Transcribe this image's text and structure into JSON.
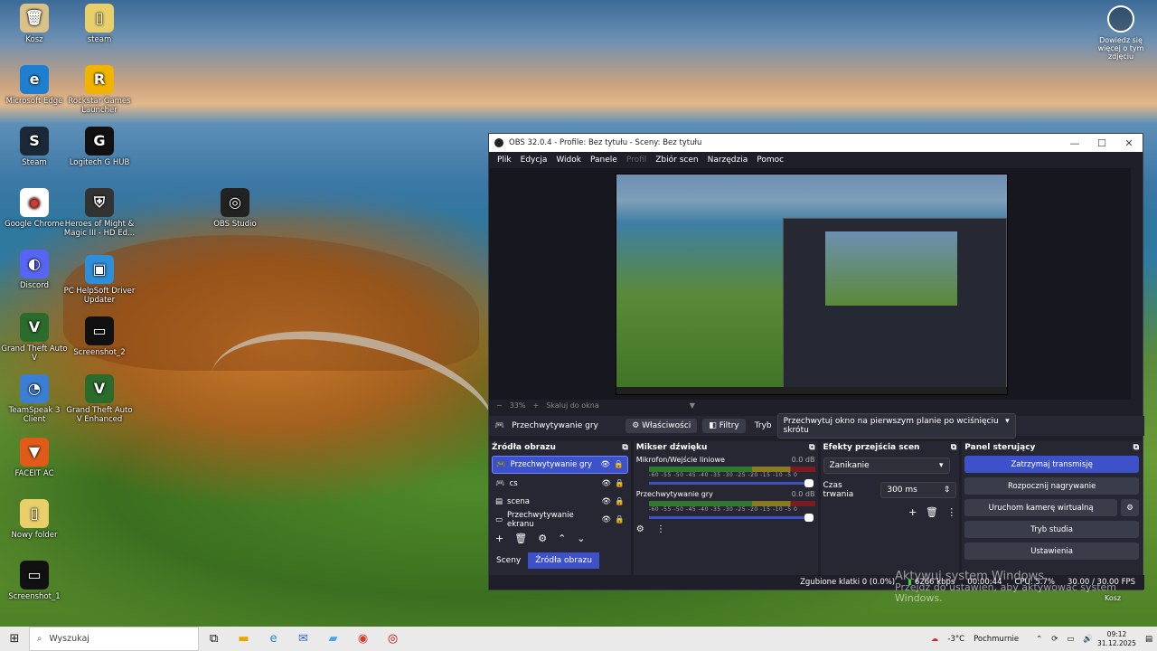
{
  "desktop": {
    "icons": [
      {
        "label": "Kosz",
        "icon": "recycle-bin-icon",
        "glyph": "🗑"
      },
      {
        "label": "steam",
        "icon": "folder-icon",
        "glyph": "▯"
      },
      {
        "label": "Microsoft Edge",
        "icon": "edge-icon",
        "glyph": "e"
      },
      {
        "label": "Rockstar Games Launcher",
        "icon": "rockstar-icon",
        "glyph": "R"
      },
      {
        "label": "Steam",
        "icon": "steam-icon",
        "glyph": "S"
      },
      {
        "label": "Logitech G HUB",
        "icon": "logitech-icon",
        "glyph": "G"
      },
      {
        "label": "Google Chrome",
        "icon": "chrome-icon",
        "glyph": "◉"
      },
      {
        "label": "Heroes of Might & Magic III - HD Ed...",
        "icon": "heroes-icon",
        "glyph": "⛨"
      },
      {
        "label": "OBS Studio",
        "icon": "obs-icon",
        "glyph": "◎"
      },
      {
        "label": "Discord",
        "icon": "discord-icon",
        "glyph": "◐"
      },
      {
        "label": "PC HelpSoft Driver Updater",
        "icon": "driver-updater-icon",
        "glyph": "▣"
      },
      {
        "label": "Grand Theft Auto V",
        "icon": "gta-icon",
        "glyph": "V"
      },
      {
        "label": "Screenshot_2",
        "icon": "screenshot-icon",
        "glyph": "▭"
      },
      {
        "label": "TeamSpeak 3 Client",
        "icon": "teamspeak-icon",
        "glyph": "◔"
      },
      {
        "label": "Grand Theft Auto V Enhanced",
        "icon": "gta-enhanced-icon",
        "glyph": "V"
      },
      {
        "label": "FACEIT AC",
        "icon": "faceit-icon",
        "glyph": "▼"
      },
      {
        "label": "Nowy folder",
        "icon": "folder-icon",
        "glyph": "▯"
      },
      {
        "label": "Screenshot_1",
        "icon": "screenshot-icon",
        "glyph": "▭"
      }
    ],
    "corner": {
      "label": "Dowiedz się więcej o tym zdjęciu"
    }
  },
  "obs": {
    "title": "OBS 32.0.4 - Profile: Bez tytułu - Sceny: Bez tytułu",
    "menu": [
      "Plik",
      "Edycja",
      "Widok",
      "Panele",
      "Profil",
      "Zbiór scen",
      "Narzędzia",
      "Pomoc"
    ],
    "zoom": {
      "minus": "−",
      "value": "33%",
      "plus": "+",
      "fit": "Skaluj do okna"
    },
    "source_bar": {
      "name": "Przechwytywanie gry",
      "properties": "Właściwości",
      "filters": "Filtry",
      "mode_label": "Tryb",
      "mode_value": "Przechwytuj okno na pierwszym planie po wciśnięciu skrótu"
    },
    "sources": {
      "title": "Źródła obrazu",
      "items": [
        {
          "name": "Przechwytywanie gry",
          "icon": "gamepad-icon"
        },
        {
          "name": "cs",
          "icon": "gamepad-icon"
        },
        {
          "name": "scena",
          "icon": "scene-icon"
        },
        {
          "name": "Przechwytywanie ekranu",
          "icon": "monitor-icon"
        }
      ]
    },
    "mixer": {
      "title": "Mikser dźwięku",
      "tracks": [
        {
          "name": "Mikrofon/Wejście liniowe",
          "db": "0.0 dB"
        },
        {
          "name": "Przechwytywanie gry",
          "db": "0.0 dB"
        }
      ],
      "ticks": "-60 -55 -50 -45 -40 -35 -30 -25 -20 -15 -10 -5 0"
    },
    "transitions": {
      "title": "Efekty przejścia scen",
      "type": "Zanikanie",
      "duration_label": "Czas trwania",
      "duration_value": "300 ms"
    },
    "controls": {
      "title": "Panel sterujący",
      "stop_stream": "Zatrzymaj transmisję",
      "start_record": "Rozpocznij nagrywanie",
      "virtual_cam": "Uruchom kamerę wirtualną",
      "studio_mode": "Tryb studia",
      "settings": "Ustawienia"
    },
    "tabs": {
      "scenes": "Sceny",
      "sources": "Źródła obrazu"
    },
    "status": {
      "dropped": "Zgubione klatki 0 (0.0%)",
      "bitrate": "6266 kbps",
      "time": "00:00:44",
      "cpu": "CPU: 5.7%",
      "fps": "30.00 / 30.00 FPS"
    }
  },
  "activation": {
    "title": "Aktywuj system Windows",
    "subtitle": "Przejdź do ustawień, aby aktywować system Windows."
  },
  "taskbar": {
    "search_placeholder": "Wyszukaj",
    "weather_temp": "-3°C",
    "weather_desc": "Pochmurnie",
    "time": "09:12",
    "date": "31.12.2025",
    "trash_label": "Kosz"
  }
}
